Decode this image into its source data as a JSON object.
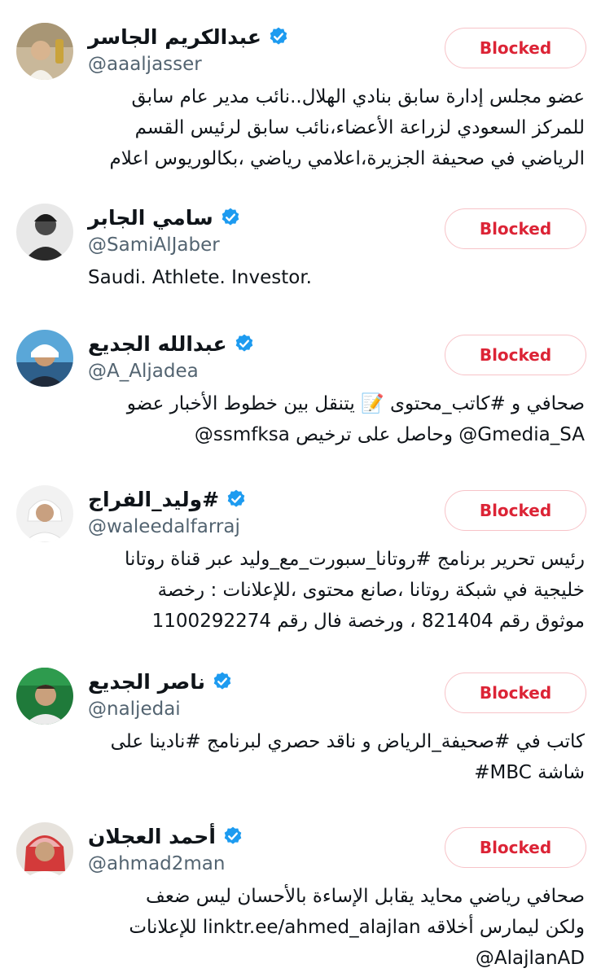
{
  "accounts": [
    {
      "name": "عبدالكريم الجاسر",
      "handle": "@aaaljasser",
      "button_label": "Blocked",
      "avatar": "avatar-portrait",
      "bio_lines": [
        "عضو مجلس إدارة سابق بنادي الهلال..نائب مدير عام سابق",
        "للمركز السعودي لزراعة الأعضاء،نائب سابق لرئيس القسم",
        "الرياضي في صحيفة الجزيرة،اعلامي رياضي ،بكالوريوس اعلام"
      ]
    },
    {
      "name": "سامي الجابر",
      "handle": "@SamiAlJaber",
      "button_label": "Blocked",
      "avatar": "avatar-portrait",
      "bio_lines": [
        "Saudi. Athlete. Investor."
      ]
    },
    {
      "name": "عبدالله الجديع",
      "handle": "@A_Aljadea",
      "button_label": "Blocked",
      "avatar": "avatar-portrait",
      "bio_lines": [
        "صحافي و #كاتب_محتوى 📝 يتنقل بين خطوط الأخبار عضو",
        "@ssmfksa وحاصل على ترخيص @Gmedia_SA"
      ]
    },
    {
      "name": "#وليد_الفراج",
      "handle": "@waleedalfarraj",
      "button_label": "Blocked",
      "avatar": "avatar-portrait",
      "bio_lines": [
        "رئيس تحرير برنامج #روتانا_سبورت_مع_وليد عبر قناة روتانا",
        "خليجية في شبكة روتانا ،صانع محتوى ،للإعلانات : رخصة",
        "موثوق رقم 821404 ، ورخصة فال رقم 1100292274"
      ]
    },
    {
      "name": "ناصر الجديع",
      "handle": "@naljedai",
      "button_label": "Blocked",
      "avatar": "avatar-portrait",
      "bio_lines": [
        "كاتب في #صحيفة_الرياض و ناقد حصري لبرنامج #نادينا على",
        "شاشة MBC#"
      ]
    },
    {
      "name": "أحمد العجلان",
      "handle": "@ahmad2man",
      "button_label": "Blocked",
      "avatar": "avatar-portrait",
      "bio_lines": [
        "صحافي رياضي محايد يقابل الإساءة بالأحسان ليس ضعف",
        "ولكن ليمارس أخلاقه linktr.ee/ahmed_alajlan للإعلانات",
        "@AlajlanAD"
      ]
    }
  ],
  "colors": {
    "verified": "#1d9bf0",
    "blocked_text": "#dc2436",
    "blocked_border": "#f7c3c8",
    "handle": "#536471",
    "text": "#0f1419"
  },
  "icons": {
    "verified": "verified-badge-icon"
  }
}
